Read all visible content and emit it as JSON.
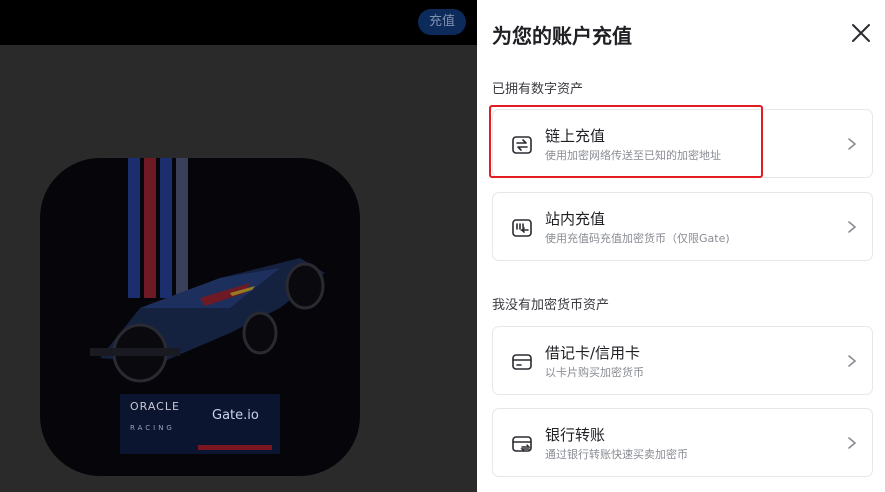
{
  "background": {
    "top_button_label": "充值",
    "promo": {
      "oracle_text": "ORACLE",
      "gate_text": "Gate.io",
      "racing_text": "RACING"
    }
  },
  "panel": {
    "title": "为您的账户充值",
    "close_icon": "close-icon",
    "section_owned": "已拥有数字资产",
    "section_none": "我没有加密货币资产",
    "options": [
      {
        "icon": "onchain-transfer-icon",
        "title": "链上充值",
        "subtitle": "使用加密网络传送至已知的加密地址"
      },
      {
        "icon": "internal-transfer-icon",
        "title": "站内充值",
        "subtitle": "使用充值码充值加密货币（仅限Gate)"
      },
      {
        "icon": "card-icon",
        "title": "借记卡/信用卡",
        "subtitle": "以卡片购买加密货币"
      },
      {
        "icon": "bank-transfer-icon",
        "title": "银行转账",
        "subtitle": "通过银行转账快速买卖加密币"
      }
    ]
  },
  "colors": {
    "highlight": "#e31b23",
    "overlay": "#2a2a2a",
    "topbar": "#000000"
  }
}
